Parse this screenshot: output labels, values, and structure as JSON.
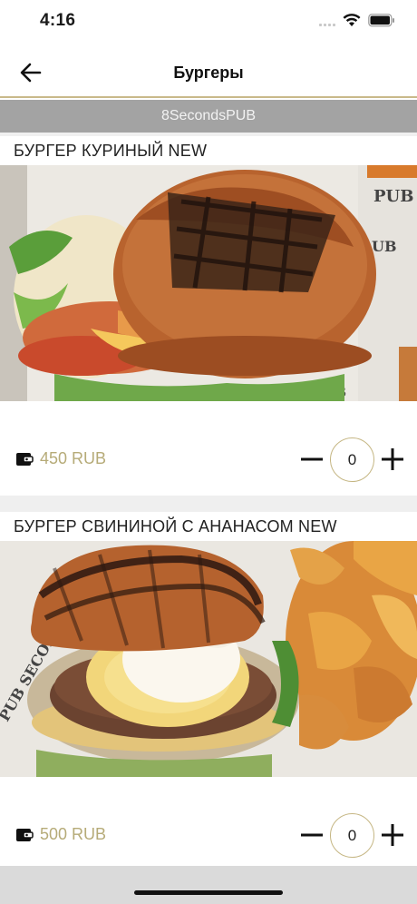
{
  "status_bar": {
    "time": "4:16"
  },
  "header": {
    "title": "Бургеры"
  },
  "store": {
    "name": "8SecondsPUB"
  },
  "products": [
    {
      "title": "БУРГЕР КУРИНЫЙ NEW",
      "price": "450 RUB",
      "quantity": "0",
      "image": "chicken-burger-photo"
    },
    {
      "title": "БУРГЕР СВИНИНОЙ С АНАНАСОМ NEW",
      "price": "500 RUB",
      "quantity": "0",
      "image": "pork-pineapple-burger-photo"
    }
  ],
  "colors": {
    "accent": "#c5b683",
    "price": "#b6ab78",
    "banner": "#a3a3a3"
  },
  "icons": [
    "back-arrow-icon",
    "wifi-icon",
    "battery-icon",
    "wallet-icon",
    "minus-icon",
    "plus-icon"
  ]
}
